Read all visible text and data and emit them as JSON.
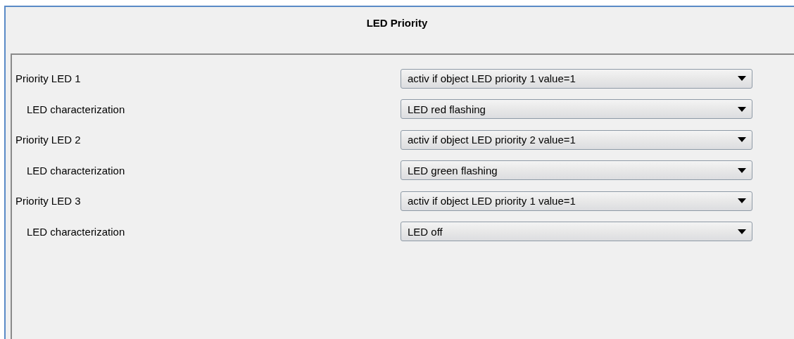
{
  "title": "LED Priority",
  "rows": [
    {
      "kind": "main",
      "label": "Priority LED 1",
      "value": "activ if object LED priority 1 value=1"
    },
    {
      "kind": "sub",
      "label": "LED characterization",
      "value": "LED red flashing"
    },
    {
      "kind": "main",
      "label": "Priority LED 2",
      "value": "activ if object LED priority 2 value=1"
    },
    {
      "kind": "sub",
      "label": "LED characterization",
      "value": "LED green flashing"
    },
    {
      "kind": "main",
      "label": "Priority LED 3",
      "value": "activ if object LED priority 1 value=1"
    },
    {
      "kind": "sub",
      "label": "LED characterization",
      "value": "LED off"
    }
  ]
}
